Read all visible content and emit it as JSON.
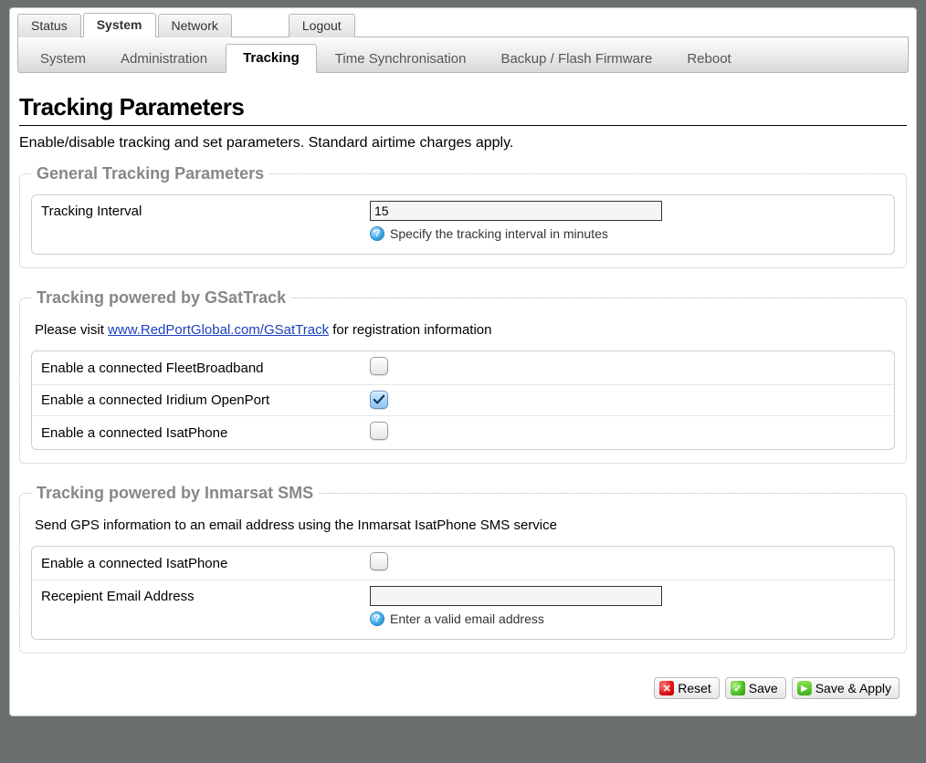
{
  "topnav": {
    "tabs": [
      {
        "label": "Status",
        "active": false
      },
      {
        "label": "System",
        "active": true
      },
      {
        "label": "Network",
        "active": false
      }
    ],
    "logout": "Logout"
  },
  "subnav": {
    "tabs": [
      {
        "label": "System",
        "active": false
      },
      {
        "label": "Administration",
        "active": false
      },
      {
        "label": "Tracking",
        "active": true
      },
      {
        "label": "Time Synchronisation",
        "active": false
      },
      {
        "label": "Backup / Flash Firmware",
        "active": false
      },
      {
        "label": "Reboot",
        "active": false
      }
    ]
  },
  "page": {
    "title": "Tracking Parameters",
    "description": "Enable/disable tracking and set parameters. Standard airtime charges apply."
  },
  "general": {
    "legend": "General Tracking Parameters",
    "interval_label": "Tracking Interval",
    "interval_value": "15",
    "interval_help": "Specify the tracking interval in minutes"
  },
  "gsat": {
    "legend": "Tracking powered by GSatTrack",
    "intro_prefix": "Please visit ",
    "intro_link": "www.RedPortGlobal.com/GSatTrack",
    "intro_suffix": " for registration information",
    "rows": [
      {
        "label": "Enable a connected FleetBroadband",
        "checked": false
      },
      {
        "label": "Enable a connected Iridium OpenPort",
        "checked": true
      },
      {
        "label": "Enable a connected IsatPhone",
        "checked": false
      }
    ]
  },
  "inmarsat": {
    "legend": "Tracking powered by Inmarsat SMS",
    "intro": "Send GPS information to an email address using the Inmarsat IsatPhone SMS service",
    "enable_label": "Enable a connected IsatPhone",
    "enable_checked": false,
    "email_label": "Recepient Email Address",
    "email_value": "",
    "email_help": "Enter a valid email address"
  },
  "footer": {
    "reset": "Reset",
    "save": "Save",
    "save_apply": "Save & Apply"
  }
}
